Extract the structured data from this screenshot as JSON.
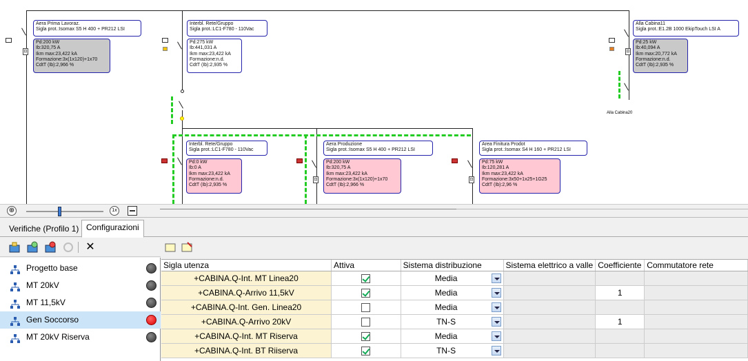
{
  "diagram": {
    "top_boxes": [
      {
        "header": "Aera Prima Lavoraz.\nSigla prot.:Isomax S5 H 400 + PR212 LSI",
        "body": "Pd:200 kW\nIb:320,75 A\nIkm max:23,422 kA\nFormazione:3x(1x120)+1x70\nCdtT (Ib):2,966 %",
        "style": "gray"
      },
      {
        "header": "Interbl. Rete/Gruppo\nSigla prot.:LC1-F780 - 110Vac",
        "body": "Pd:275 kW\nIb:441,031 A\nIkm max:23,422 kA\nFormazione:n.d.\nCdtT (Ib):2,935 %",
        "style": "white"
      },
      {
        "header": "Alla Cabina11\nSigla prot.:E1.2B 1000 EkipTouch LSI A",
        "body": "Pd:25 kW\nIb:40,094 A\nIkm max:20,772 kA\nFormazione:n.d.\nCdtT (Ib):2,935 %",
        "style": "gray"
      }
    ],
    "bottom_boxes": [
      {
        "header": "Interbl. Rete/Gruppo\nSigla prot.:LC1-F780 - 110Vac",
        "body": "Pd:0 kW\nIb:0 A\nIkm max:23,422 kA\nFormazione:n.d.\nCdtT (Ib):2,935 %"
      },
      {
        "header": "Aera Produzione\nSigla prot.:Isomax S5 H 400 + PR212 LSI",
        "body": "Pd:200 kW\nIb:320,75 A\nIkm max:23,422 kA\nFormazione:3x(1x120)+1x70\nCdtT (Ib):2,966 %"
      },
      {
        "header": "Area Finitura Prodot\nSigla prot.:Isomax S4 H 160 + PR212 LSI",
        "body": "Pd:75 kW\nIb:120,281 A\nIkm max:23,422 kA\nFormazione:3x50+1x25+1G25\nCdtT (Ib):2,96 %"
      }
    ],
    "cabina_label": "Alla Cabina20"
  },
  "zoom": {
    "reset_label": "1x",
    "level_fraction": 0.42
  },
  "tabs": [
    {
      "label": "Verifiche (Profilo 1)"
    },
    {
      "label": "Configurazioni"
    }
  ],
  "configs": [
    {
      "name": "Progetto base",
      "status": "gray"
    },
    {
      "name": "MT 20kV",
      "status": "gray"
    },
    {
      "name": "MT 11,5kV",
      "status": "gray"
    },
    {
      "name": "Gen Soccorso",
      "status": "red"
    },
    {
      "name": "MT 20kV Riserva",
      "status": "gray"
    }
  ],
  "grid": {
    "headers": [
      "Sigla utenza",
      "Attiva",
      "Sistema distribuzione",
      "Sistema elettrico a valle",
      "Coefficiente",
      "Commutatore rete"
    ],
    "rows": [
      {
        "sigla": "+CABINA.Q-Int. MT Linea20",
        "attiva": true,
        "sistema": "Media",
        "coeff": ""
      },
      {
        "sigla": "+CABINA.Q-Arrivo 11,5kV",
        "attiva": true,
        "sistema": "Media",
        "coeff": "1"
      },
      {
        "sigla": "+CABINA.Q-Int. Gen. Linea20",
        "attiva": false,
        "sistema": "Media",
        "coeff": ""
      },
      {
        "sigla": "+CABINA.Q-Arrivo 20kV",
        "attiva": false,
        "sistema": "TN-S",
        "coeff": "1"
      },
      {
        "sigla": "+CABINA.Q-Int. MT Riserva",
        "attiva": true,
        "sistema": "Media",
        "coeff": ""
      },
      {
        "sigla": "+CABINA.Q-Int. BT Riiserva",
        "attiva": true,
        "sistema": "TN-S",
        "coeff": ""
      }
    ]
  },
  "colors": {
    "selected_row": "#cce4f7",
    "sigla_bg": "#fbf3d1",
    "status_red": "#e00000",
    "dashed_line": "#22cc22"
  }
}
